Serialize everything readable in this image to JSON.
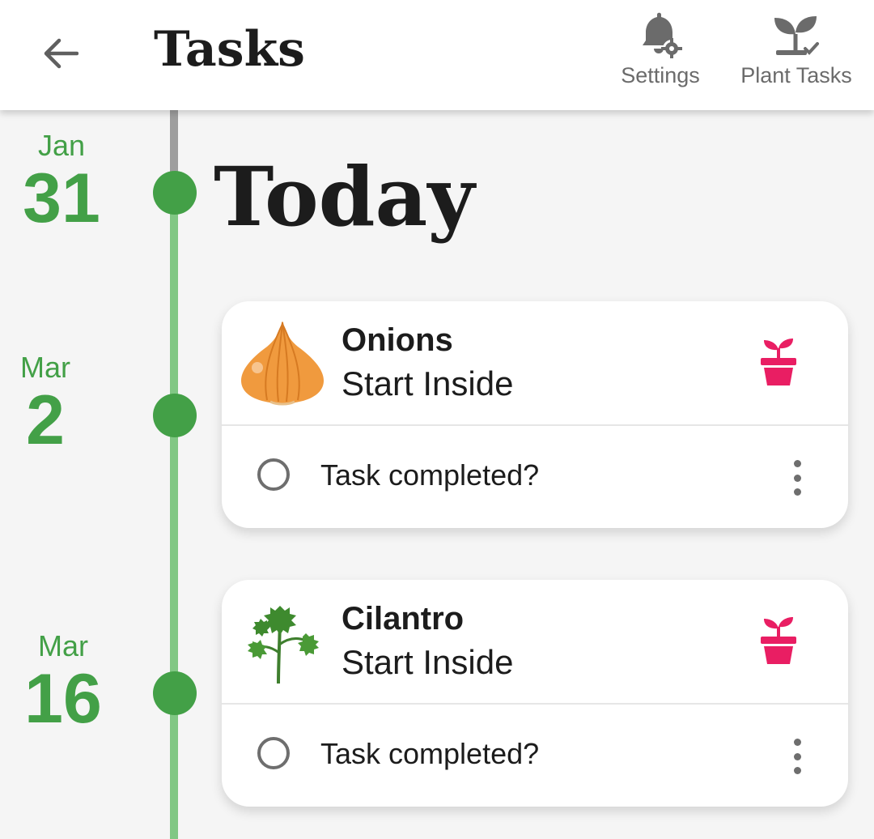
{
  "header": {
    "title": "Tasks",
    "actions": [
      {
        "label": "Settings",
        "icon": "bell-gear-icon"
      },
      {
        "label": "Plant Tasks",
        "icon": "plant-check-icon"
      }
    ]
  },
  "timeline": {
    "today_label": "Today",
    "dates": [
      {
        "month": "Jan",
        "day": "31"
      },
      {
        "month": "Mar",
        "day": "2"
      },
      {
        "month": "Mar",
        "day": "16"
      }
    ]
  },
  "cards": [
    {
      "plant": "Onions",
      "task": "Start Inside",
      "complete_label": "Task completed?",
      "plant_icon": "onion-icon",
      "task_icon": "pot-sprout-icon"
    },
    {
      "plant": "Cilantro",
      "task": "Start Inside",
      "complete_label": "Task completed?",
      "plant_icon": "cilantro-icon",
      "task_icon": "pot-sprout-icon"
    }
  ],
  "colors": {
    "accent_green": "#43a047",
    "timeline_light": "#81c784",
    "pot_pink": "#e91e63"
  }
}
